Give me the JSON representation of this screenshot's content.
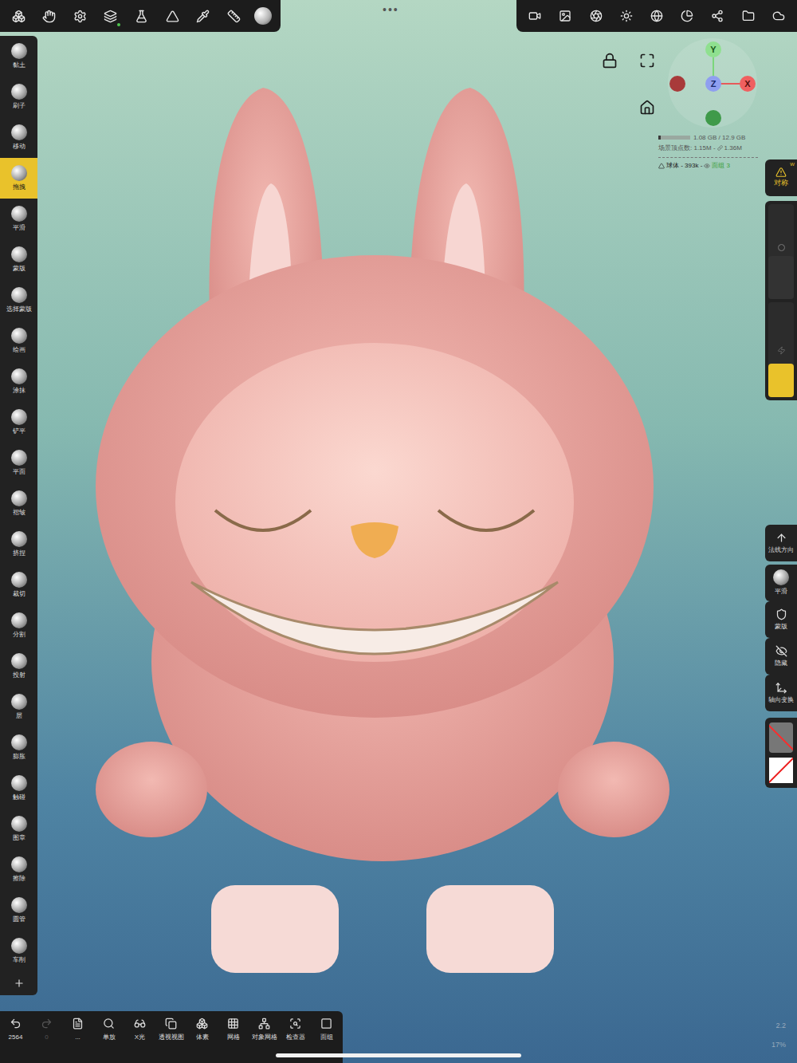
{
  "more_menu": "•••",
  "left_tools": [
    {
      "label": "黏土",
      "selected": false
    },
    {
      "label": "刷子",
      "selected": false
    },
    {
      "label": "移动",
      "selected": false
    },
    {
      "label": "拖拽",
      "selected": true
    },
    {
      "label": "平滑",
      "selected": false
    },
    {
      "label": "蒙版",
      "selected": false
    },
    {
      "label": "选择蒙版",
      "selected": false
    },
    {
      "label": "绘画",
      "selected": false
    },
    {
      "label": "涂抹",
      "selected": false
    },
    {
      "label": "铲平",
      "selected": false
    },
    {
      "label": "平面",
      "selected": false
    },
    {
      "label": "褶皱",
      "selected": false
    },
    {
      "label": "挤捏",
      "selected": false
    },
    {
      "label": "裁切",
      "selected": false
    },
    {
      "label": "分割",
      "selected": false
    },
    {
      "label": "投射",
      "selected": false
    },
    {
      "label": "层",
      "selected": false
    },
    {
      "label": "膨胀",
      "selected": false
    },
    {
      "label": "触碰",
      "selected": false
    },
    {
      "label": "图章",
      "selected": false
    },
    {
      "label": "擦除",
      "selected": false
    },
    {
      "label": "圆管",
      "selected": false
    },
    {
      "label": "车削",
      "selected": false
    }
  ],
  "gizmo": {
    "y": "Y",
    "z": "Z",
    "x": "X"
  },
  "stats": {
    "memory": "1.08 GB / 12.9 GB",
    "memory_level": 0.08,
    "vertices": "场景顶点数: 1.15M -",
    "linked": "1.36M",
    "object": "球体 - 393k -",
    "face_groups": "面组 3"
  },
  "symmetry": {
    "label": "对称",
    "badge": "W",
    "warning": true
  },
  "sliders": {
    "radius_level": 0.45,
    "intensity_level": 0.35
  },
  "right_tools": [
    {
      "label": "法线方向"
    },
    {
      "label": "平滑"
    },
    {
      "label": "蒙版"
    },
    {
      "label": "隐藏"
    },
    {
      "label": "轴向变换"
    }
  ],
  "bottom_toolbar": [
    {
      "label": "2564",
      "disabled": false
    },
    {
      "label": "0",
      "disabled": true
    },
    {
      "label": "...",
      "disabled": false
    },
    {
      "label": "单放",
      "disabled": false
    },
    {
      "label": "X光",
      "disabled": false
    },
    {
      "label": "透视视图",
      "disabled": false
    },
    {
      "label": "体素",
      "disabled": false
    },
    {
      "label": "网格",
      "disabled": false
    },
    {
      "label": "对象网格",
      "disabled": false
    },
    {
      "label": "检查器",
      "disabled": false
    },
    {
      "label": "面组",
      "disabled": false
    }
  ],
  "status": {
    "version": "2.2",
    "zoom": "17%"
  }
}
